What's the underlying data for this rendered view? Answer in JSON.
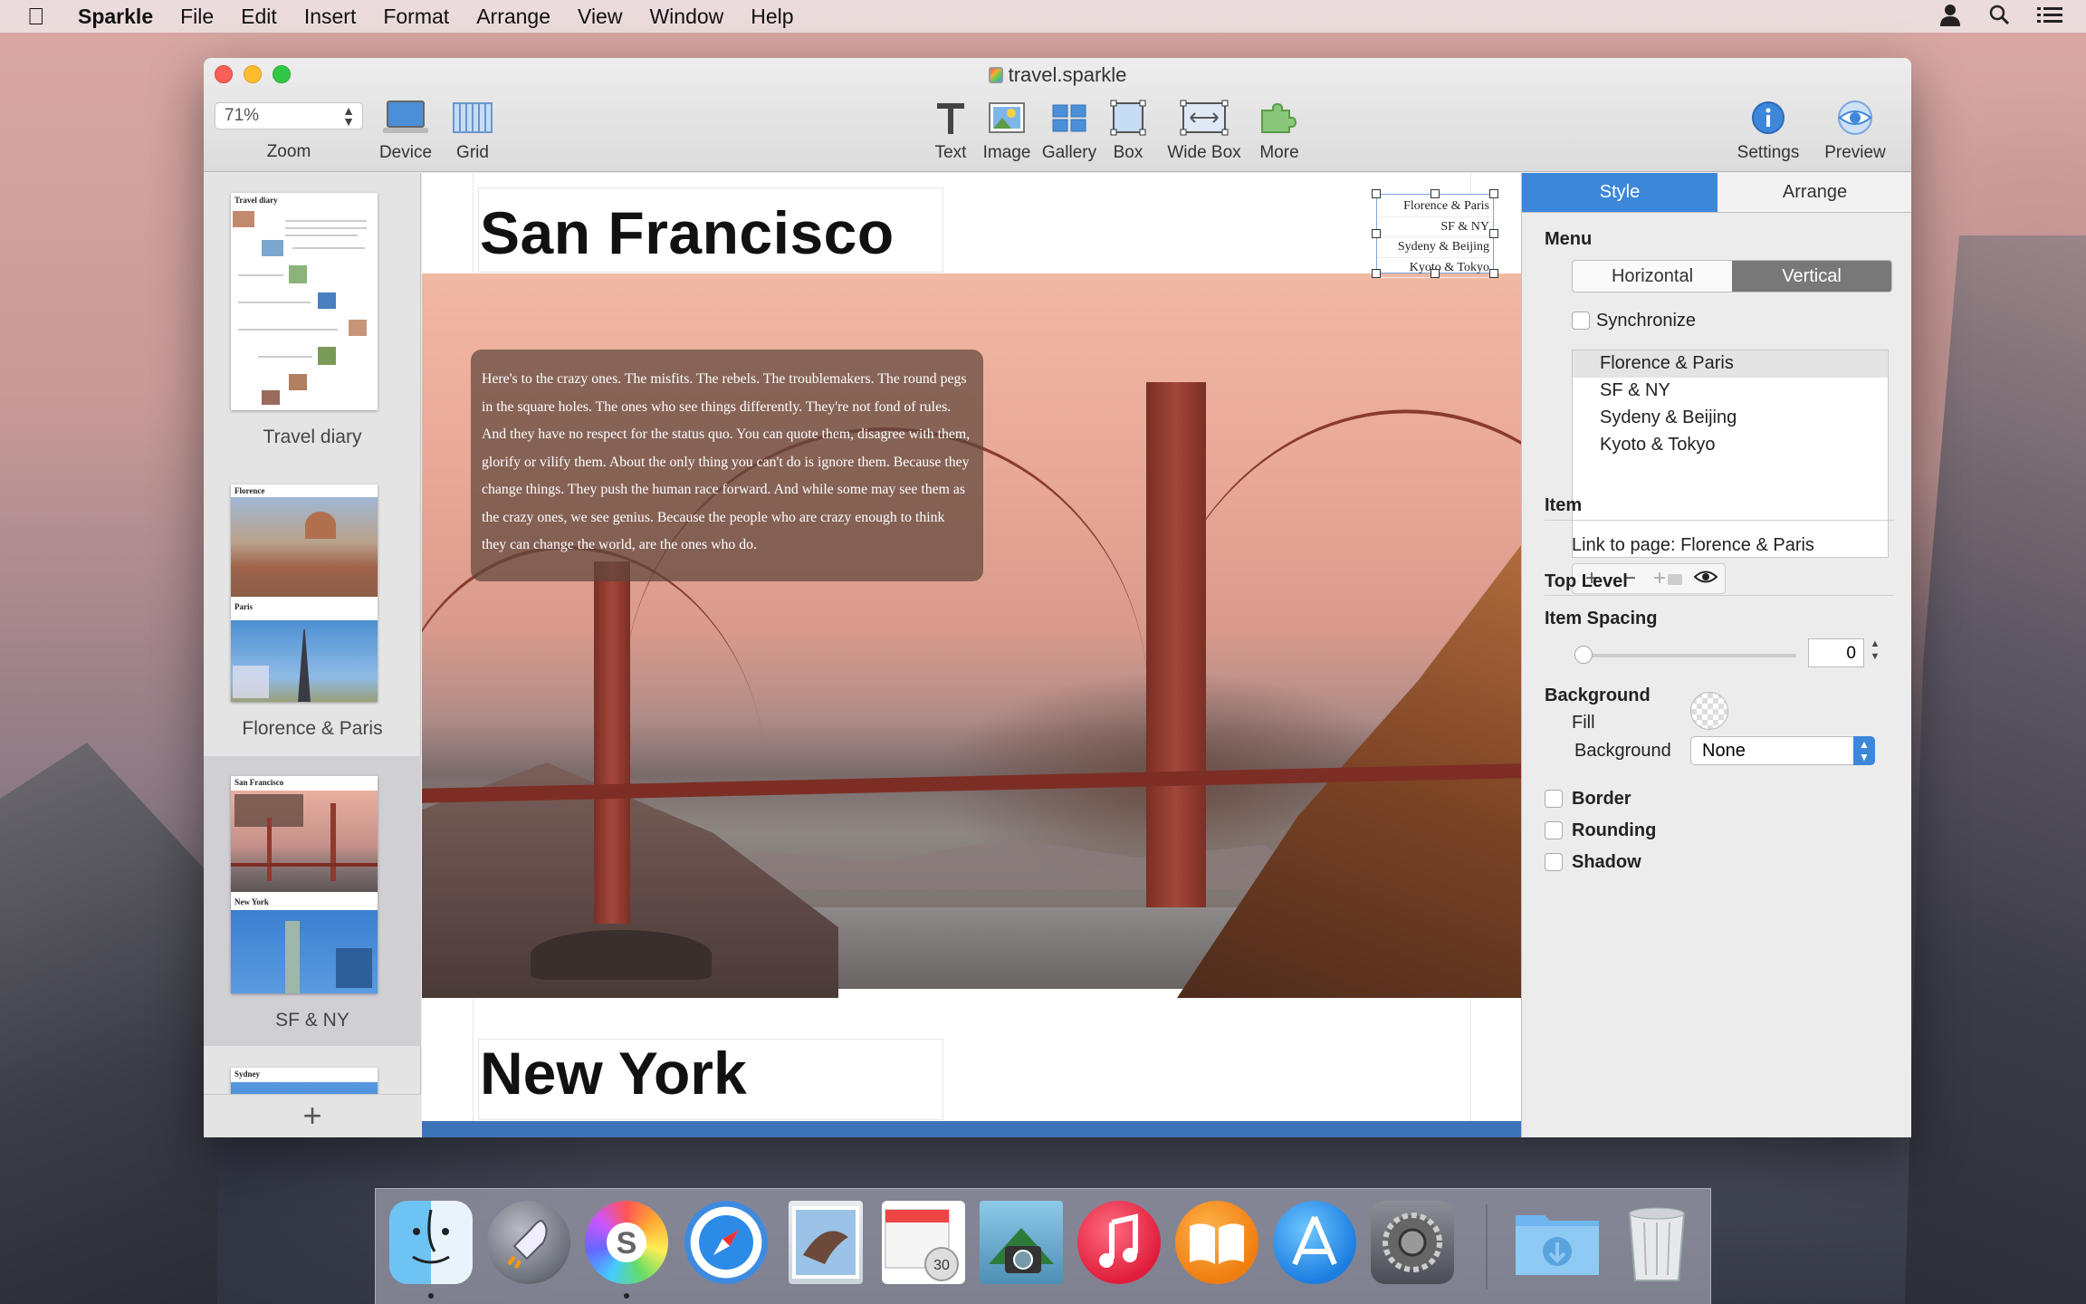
{
  "menubar": {
    "apple": "",
    "app_name": "Sparkle",
    "items": [
      "File",
      "Edit",
      "Insert",
      "Format",
      "Arrange",
      "View",
      "Window",
      "Help"
    ],
    "right_icons": [
      "user-icon",
      "search-icon",
      "list-icon"
    ]
  },
  "window": {
    "title": "travel.sparkle",
    "toolbar": {
      "zoom_value": "71%",
      "zoom_label": "Zoom",
      "device_label": "Device",
      "grid_label": "Grid",
      "text_label": "Text",
      "image_label": "Image",
      "gallery_label": "Gallery",
      "box_label": "Box",
      "widebox_label": "Wide Box",
      "more_label": "More",
      "settings_label": "Settings",
      "preview_label": "Preview"
    }
  },
  "sidebar": {
    "pages": [
      {
        "label": "Travel diary",
        "thumb_heading": "Travel diary"
      },
      {
        "label": "Florence & Paris",
        "thumb_heading": "Florence",
        "thumb_heading2": "Paris"
      },
      {
        "label": "SF & NY",
        "thumb_heading": "San Francisco",
        "thumb_heading2": "New York"
      },
      {
        "label": "",
        "thumb_heading": "Sydney"
      }
    ],
    "add_label": "+"
  },
  "canvas": {
    "heading_1": "San Francisco",
    "heading_2": "New York",
    "body_text": "Here's to the crazy ones. The misfits. The rebels. The troublemakers. The round pegs in the square holes. The ones who see things differently. They're not fond of rules. And they have no respect for the status quo. You can quote them, disagree with them, glorify or vilify them. About the only thing you can't do is ignore them. Because they change things. They push the human race forward. And while some may see them as the crazy ones, we see genius. Because the people who are crazy enough to think they can change the world, are the ones who do.",
    "menu_widget_items": [
      "Florence & Paris",
      "SF & NY",
      "Sydeny & Beijing",
      "Kyoto & Tokyo"
    ]
  },
  "inspector": {
    "tabs": [
      "Style",
      "Arrange"
    ],
    "active_tab": "Style",
    "menu_heading": "Menu",
    "orientation": [
      "Horizontal",
      "Vertical"
    ],
    "orientation_selected": "Vertical",
    "synchronize_label": "Synchronize",
    "menu_items": [
      "Florence & Paris",
      "SF & NY",
      "Sydeny & Beijing",
      "Kyoto & Tokyo"
    ],
    "list_buttons": [
      "+",
      "−",
      "+",
      "eye-icon"
    ],
    "item_heading": "Item",
    "link_text": "Link to page: Florence & Paris",
    "top_level_heading": "Top Level",
    "item_spacing_heading": "Item Spacing",
    "item_spacing_value": "0",
    "background_heading": "Background",
    "fill_label": "Fill",
    "background_label": "Background",
    "background_value": "None",
    "border_label": "Border",
    "rounding_label": "Rounding",
    "shadow_label": "Shadow"
  },
  "dock": {
    "apps": [
      "finder-icon",
      "launchpad-icon",
      "sparkle-icon",
      "safari-icon",
      "mail-icon",
      "calendar-icon",
      "photo-booth-icon",
      "itunes-icon",
      "ibooks-icon",
      "app-store-icon",
      "system-preferences-icon",
      "downloads-folder-icon",
      "trash-icon"
    ]
  },
  "colors": {
    "accent": "#3d87db",
    "close": "#fc5f57",
    "minimize": "#fdbc2e",
    "zoom": "#33c748"
  }
}
